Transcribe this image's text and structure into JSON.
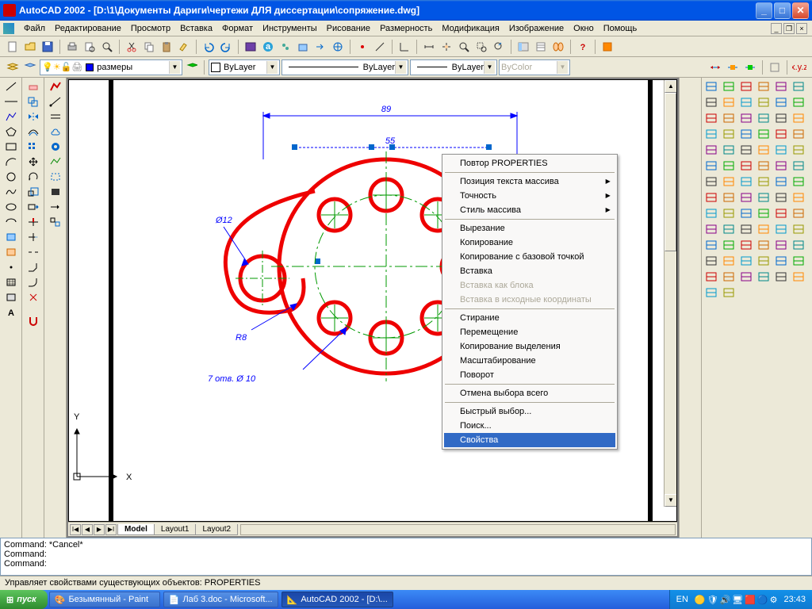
{
  "title": "AutoCAD 2002 - [D:\\1\\Документы Дариги\\чертежи ДЛЯ диссертации\\сопряжение.dwg]",
  "menu": [
    "Файл",
    "Редактирование",
    "Просмотр",
    "Вставка",
    "Формат",
    "Инструменты",
    "Рисование",
    "Размерность",
    "Модификация",
    "Изображение",
    "Окно",
    "Помощь"
  ],
  "layer_dropdown": "размеры",
  "bylayer1": "ByLayer",
  "bylayer2": "ByLayer",
  "bylayer3": "ByLayer",
  "bycolor": "ByColor",
  "tabs": {
    "active": "Model",
    "others": [
      "Layout1",
      "Layout2"
    ]
  },
  "command_lines": [
    "Command: *Cancel*",
    "Command:",
    "Command:"
  ],
  "status": "Управляет свойствами существующих объектов: PROPERTIES",
  "dimensions": {
    "d1": "89",
    "d2": "55",
    "phi": "Ø12",
    "r": "R8",
    "note": "7 отв. Ø 10",
    "axes": {
      "x": "X",
      "y": "Y"
    }
  },
  "context_menu": {
    "items": [
      {
        "label": "Повтор PROPERTIES",
        "type": "item"
      },
      {
        "type": "sep"
      },
      {
        "label": "Позиция текста массива",
        "type": "sub"
      },
      {
        "label": "Точность",
        "type": "sub"
      },
      {
        "label": "Стиль массива",
        "type": "sub"
      },
      {
        "type": "sep"
      },
      {
        "label": "Вырезание",
        "type": "item"
      },
      {
        "label": "Копирование",
        "type": "item"
      },
      {
        "label": "Копирование с базовой точкой",
        "type": "item"
      },
      {
        "label": "Вставка",
        "type": "item"
      },
      {
        "label": "Вставка как блока",
        "type": "disabled"
      },
      {
        "label": "Вставка в исходные координаты",
        "type": "disabled"
      },
      {
        "type": "sep"
      },
      {
        "label": "Стирание",
        "type": "item"
      },
      {
        "label": "Перемещение",
        "type": "item"
      },
      {
        "label": "Копирование выделения",
        "type": "item"
      },
      {
        "label": "Масштабирование",
        "type": "item"
      },
      {
        "label": "Поворот",
        "type": "item"
      },
      {
        "type": "sep"
      },
      {
        "label": "Отмена выбора всего",
        "type": "item"
      },
      {
        "type": "sep"
      },
      {
        "label": "Быстрый выбор...",
        "type": "item"
      },
      {
        "label": "Поиск...",
        "type": "item"
      },
      {
        "label": "Свойства",
        "type": "highlight"
      }
    ]
  },
  "taskbar": {
    "start": "пуск",
    "buttons": [
      {
        "label": "Безымянный - Paint",
        "active": false
      },
      {
        "label": "Лаб 3.doc - Microsoft...",
        "active": false
      },
      {
        "label": "AutoCAD 2002 - [D:\\...",
        "active": true
      }
    ],
    "lang": "EN",
    "time": "23:43"
  }
}
